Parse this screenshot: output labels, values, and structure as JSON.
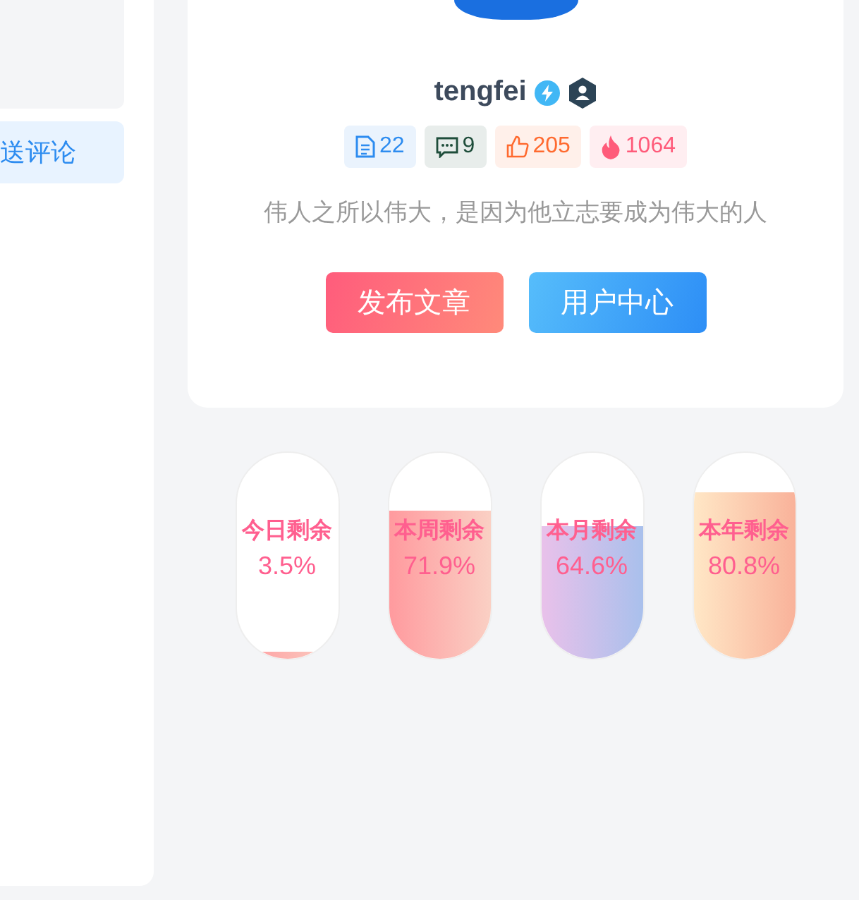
{
  "comment_button": {
    "label": "送评论"
  },
  "profile": {
    "name": "tengfei",
    "quote": "伟人之所以伟大，是因为他立志要成为伟大的人",
    "stats": [
      {
        "kind": "article",
        "value": "22",
        "color": "#2d8cf0"
      },
      {
        "kind": "comment",
        "value": "9",
        "color": "#1e4d3a"
      },
      {
        "kind": "like",
        "value": "205",
        "color": "#ff6a2f"
      },
      {
        "kind": "hot",
        "value": "1064",
        "color": "#ff5b7a"
      }
    ],
    "buttons": [
      {
        "label": "发布文章",
        "kind": "primary"
      },
      {
        "label": "用户中心",
        "kind": "secondary"
      }
    ]
  },
  "progress": [
    {
      "label": "今日剩余",
      "reading": "3.5%",
      "level": 0.035,
      "kind": "coral"
    },
    {
      "label": "本周剩余",
      "reading": "71.9%",
      "level": 0.719,
      "kind": "coral"
    },
    {
      "label": "本月剩余",
      "reading": "64.6%",
      "level": 0.646,
      "kind": "lilac"
    },
    {
      "label": "本年剩余",
      "reading": "80.8%",
      "level": 0.808,
      "kind": "peach"
    }
  ]
}
